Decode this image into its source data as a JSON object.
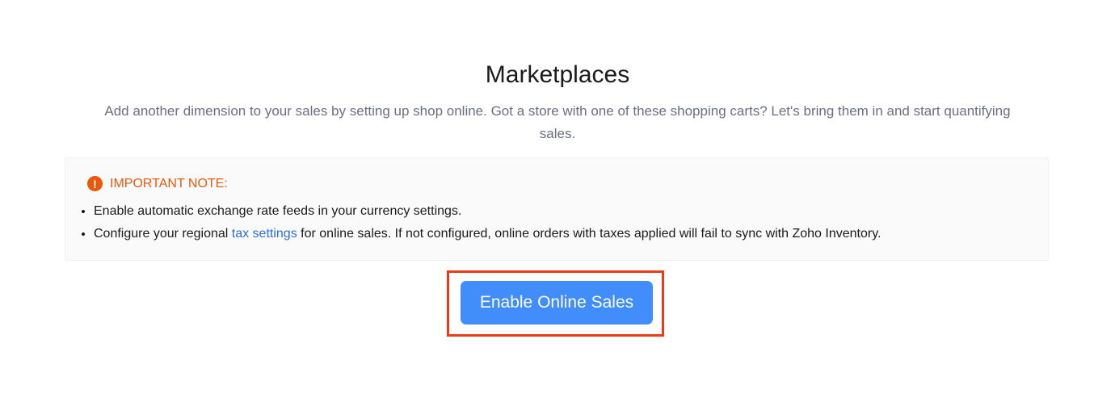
{
  "header": {
    "title": "Marketplaces",
    "subtitle": "Add another dimension to your sales by setting up shop online. Got a store with one of these shopping carts? Let's bring them in and start quantifying sales."
  },
  "note": {
    "icon": "exclamation-circle-icon",
    "icon_glyph": "!",
    "heading": "IMPORTANT NOTE:",
    "accent_color": "#e8590c",
    "items": [
      {
        "text": "Enable automatic exchange rate feeds in your currency settings."
      },
      {
        "prefix": "Configure your regional ",
        "link": "tax settings",
        "suffix": " for online sales. If not configured, online orders with taxes applied will fail to sync with Zoho Inventory."
      }
    ]
  },
  "action": {
    "button_label": "Enable Online Sales",
    "button_color": "#408dfb",
    "highlight_color": "#f03a17"
  }
}
